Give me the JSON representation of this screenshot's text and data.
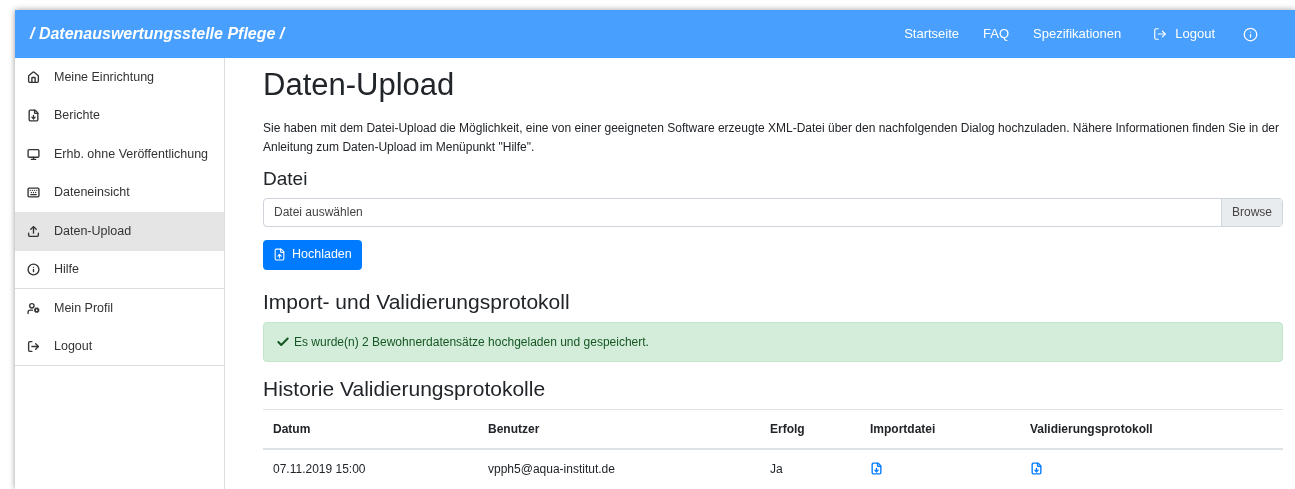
{
  "brand": "/ Datenauswertungsstelle Pflege /",
  "nav": [
    {
      "kind": "link",
      "label": "Startseite"
    },
    {
      "kind": "link",
      "label": "FAQ"
    },
    {
      "kind": "link",
      "label": "Spezifikationen"
    },
    {
      "kind": "logout",
      "label": "Logout"
    },
    {
      "kind": "info"
    }
  ],
  "sidebar": {
    "items": [
      {
        "label": "Meine Einrichtung",
        "selected": false
      },
      {
        "label": "Berichte",
        "selected": false
      },
      {
        "label": "Erhb. ohne Veröffentlichung",
        "selected": false
      },
      {
        "label": "Dateneinsicht",
        "selected": false
      },
      {
        "label": "Daten-Upload",
        "selected": true
      },
      {
        "label": "Hilfe",
        "selected": false
      },
      {
        "label": "Mein Profil",
        "selected": false
      },
      {
        "label": "Logout",
        "selected": false
      }
    ]
  },
  "page_title": "Daten-Upload",
  "intro": "Sie haben mit dem Datei-Upload die Möglichkeit, eine von einer geeigneten Software erzeugte XML-Datei über den nachfolgenden Dialog hochzuladen. Nähere Informationen finden Sie in der Anleitung zum Daten-Upload im Menüpunkt \"Hilfe\".",
  "file_section": {
    "title": "Datei",
    "placeholder": "Datei auswählen",
    "browse": "Browse",
    "upload_button": "Hochladen"
  },
  "protocol": {
    "title": "Import- und Validierungsprotokoll",
    "alert": "Es wurde(n) 2 Bewohnerdatensätze hochgeladen und gespeichert."
  },
  "history": {
    "title": "Historie Validierungsprotokolle",
    "columns": [
      "Datum",
      "Benutzer",
      "Erfolg",
      "Importdatei",
      "Validierungsprotokoll"
    ],
    "rows": [
      {
        "datum": "07.11.2019 15:00",
        "benutzer": "vpph5@aqua-institut.de",
        "erfolg": "Ja"
      }
    ]
  }
}
